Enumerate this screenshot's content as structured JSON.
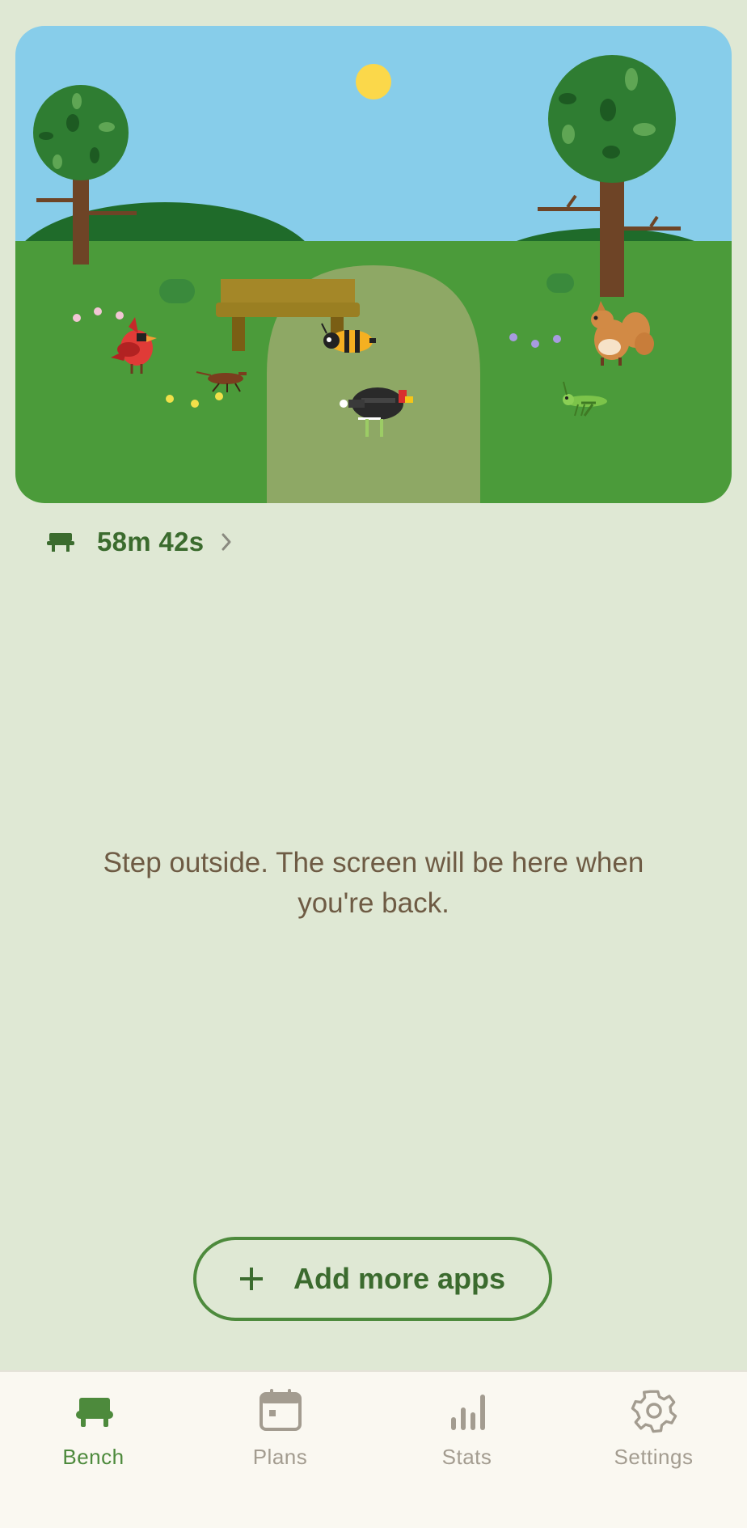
{
  "scene": {
    "description_icons": [
      "sun-icon",
      "tree-icon",
      "bench-icon",
      "cardinal-bird-icon",
      "bee-icon",
      "turkey-icon",
      "squirrel-icon",
      "grasshopper-icon",
      "beetle-icon"
    ]
  },
  "timer": {
    "icon": "bench-icon",
    "value": "58m 42s",
    "chevron": "chevron-right-icon"
  },
  "message": "Step outside. The screen will be here when you're back.",
  "add_button": {
    "icon": "plus-icon",
    "label": "Add more apps"
  },
  "tabs": [
    {
      "label": "Bench",
      "icon": "bench-icon",
      "active": true
    },
    {
      "label": "Plans",
      "icon": "calendar-icon",
      "active": false
    },
    {
      "label": "Stats",
      "icon": "bar-chart-icon",
      "active": false
    },
    {
      "label": "Settings",
      "icon": "gear-icon",
      "active": false
    }
  ],
  "colors": {
    "background": "#dfe8d4",
    "accent": "#4d8a3c",
    "accent_text": "#3b6b2e",
    "sky": "#87cdea",
    "grass": "#4b9b3a",
    "path": "#8ea865",
    "inactive_tab": "#a39c90",
    "message_text": "#6e5b44"
  }
}
